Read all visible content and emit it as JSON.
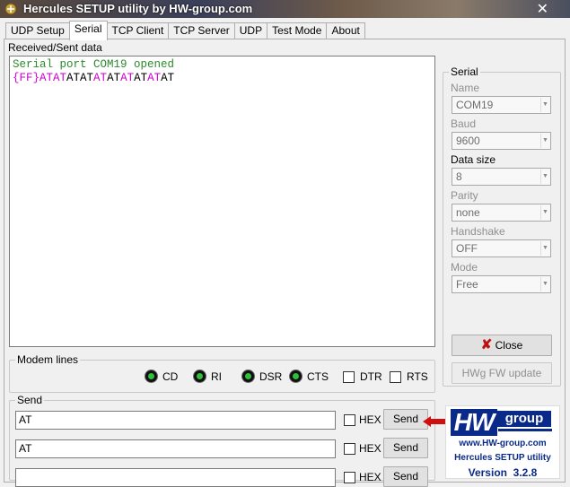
{
  "window": {
    "title": "Hercules SETUP utility by HW-group.com",
    "close_glyph": "✕"
  },
  "tabs": [
    {
      "label": "UDP Setup"
    },
    {
      "label": "Serial"
    },
    {
      "label": "TCP Client"
    },
    {
      "label": "TCP Server"
    },
    {
      "label": "UDP"
    },
    {
      "label": "Test Mode"
    },
    {
      "label": "About"
    }
  ],
  "received": {
    "label": "Received/Sent data",
    "line1": "Serial port COM19 opened",
    "line2": [
      {
        "text": "{FF}",
        "color": "#cc00cc"
      },
      {
        "text": "ATAT",
        "color": "#cc00cc"
      },
      {
        "text": "ATAT",
        "color": "#000000"
      },
      {
        "text": "AT",
        "color": "#cc00cc"
      },
      {
        "text": "AT",
        "color": "#000000"
      },
      {
        "text": "AT",
        "color": "#cc00cc"
      },
      {
        "text": "AT",
        "color": "#000000"
      },
      {
        "text": "AT",
        "color": "#cc00cc"
      },
      {
        "text": "AT",
        "color": "#000000"
      }
    ]
  },
  "modem": {
    "title": "Modem lines",
    "cd": "CD",
    "ri": "RI",
    "dsr": "DSR",
    "cts": "CTS",
    "dtr": "DTR",
    "rts": "RTS"
  },
  "send": {
    "title": "Send",
    "hex_label": "HEX",
    "button_label": "Send",
    "rows": [
      {
        "value": "AT"
      },
      {
        "value": "AT"
      },
      {
        "value": ""
      }
    ]
  },
  "serial": {
    "title": "Serial",
    "name_label": "Name",
    "name_value": "COM19",
    "baud_label": "Baud",
    "baud_value": "9600",
    "datasize_label": "Data size",
    "datasize_value": "8",
    "parity_label": "Parity",
    "parity_value": "none",
    "handshake_label": "Handshake",
    "handshake_value": "OFF",
    "mode_label": "Mode",
    "mode_value": "Free",
    "close_label": "Close",
    "fwupdate_label": "HWg FW update"
  },
  "logo": {
    "hw": "HW",
    "group": "group",
    "url": "www.HW-group.com",
    "product": "Hercules SETUP utility",
    "version_label": "Version",
    "version_value": "3.2.8"
  },
  "colors": {
    "accent_green": "#2a8a2a",
    "magenta": "#cc00cc",
    "logo_blue": "#0a2a8a",
    "arrow_red": "#d01010"
  }
}
